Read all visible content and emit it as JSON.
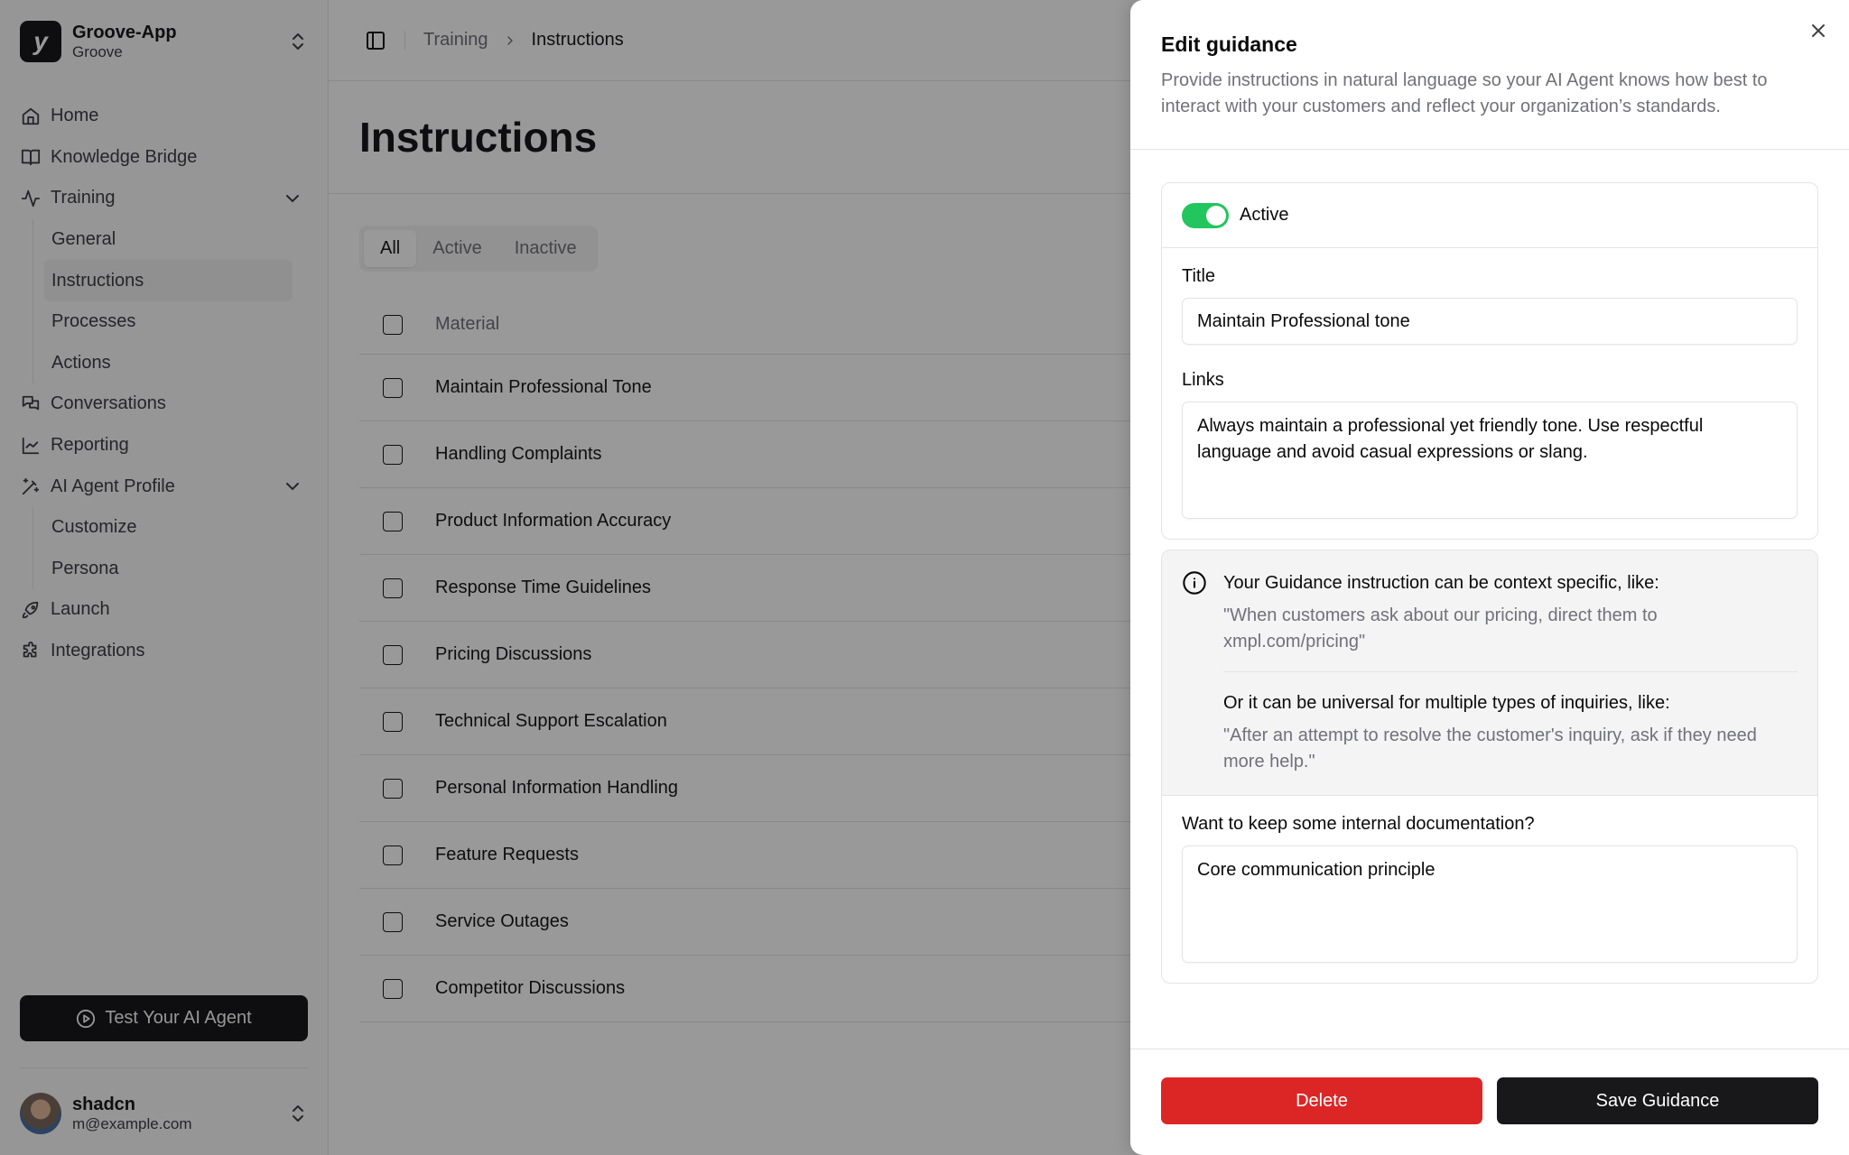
{
  "sidebar": {
    "team": {
      "logo": "y",
      "name": "Groove-App",
      "subtitle": "Groove"
    },
    "nav": [
      {
        "label": "Home",
        "icon": "home-icon"
      },
      {
        "label": "Knowledge Bridge",
        "icon": "book-open-icon"
      },
      {
        "label": "Training",
        "icon": "activity-icon",
        "expanded": true,
        "children": [
          {
            "label": "General"
          },
          {
            "label": "Instructions",
            "active": true
          },
          {
            "label": "Processes"
          },
          {
            "label": "Actions"
          }
        ]
      },
      {
        "label": "Conversations",
        "icon": "messages-icon"
      },
      {
        "label": "Reporting",
        "icon": "chart-line-icon"
      },
      {
        "label": "AI Agent Profile",
        "icon": "wand-sparkles-icon",
        "expanded": true,
        "children": [
          {
            "label": "Customize"
          },
          {
            "label": "Persona"
          }
        ]
      },
      {
        "label": "Launch",
        "icon": "rocket-icon"
      },
      {
        "label": "Integrations",
        "icon": "puzzle-icon"
      }
    ],
    "test_button": "Test Your AI Agent",
    "user": {
      "name": "shadcn",
      "email": "m@example.com"
    }
  },
  "header": {
    "breadcrumb": [
      "Training",
      "Instructions"
    ]
  },
  "page": {
    "title": "Instructions",
    "tabs": [
      {
        "label": "All",
        "active": true
      },
      {
        "label": "Active"
      },
      {
        "label": "Inactive"
      }
    ],
    "table": {
      "column": "Material",
      "rows": [
        "Maintain Professional Tone",
        "Handling Complaints",
        "Product Information Accuracy",
        "Response Time Guidelines",
        "Pricing Discussions",
        "Technical Support Escalation",
        "Personal Information Handling",
        "Feature Requests",
        "Service Outages",
        "Competitor Discussions"
      ]
    }
  },
  "sheet": {
    "title": "Edit guidance",
    "description": "Provide instructions in natural language so your AI Agent knows how best to interact with your customers and reflect your organization’s standards.",
    "active_label": "Active",
    "active": true,
    "title_label": "Title",
    "title_value": "Maintain Professional tone",
    "links_label": "Links",
    "links_value": "Always maintain a professional yet friendly tone. Use respectful language and avoid casual expressions or slang.",
    "info": {
      "heading1": "Your Guidance instruction can be context specific, like:",
      "quote1": "\"When customers ask about our pricing, direct them to xmpl.com/pricing\"",
      "heading2": "Or it can be universal for multiple types of inquiries, like:",
      "quote2": "\"After an attempt to resolve the customer's inquiry, ask if they need more help.\""
    },
    "doc_label": "Want to keep some internal documentation?",
    "doc_value": "Core communication principle",
    "delete_label": "Delete",
    "save_label": "Save Guidance"
  },
  "colors": {
    "accent_green": "#22c55e",
    "danger": "#dc2626",
    "primary": "#18181b"
  }
}
